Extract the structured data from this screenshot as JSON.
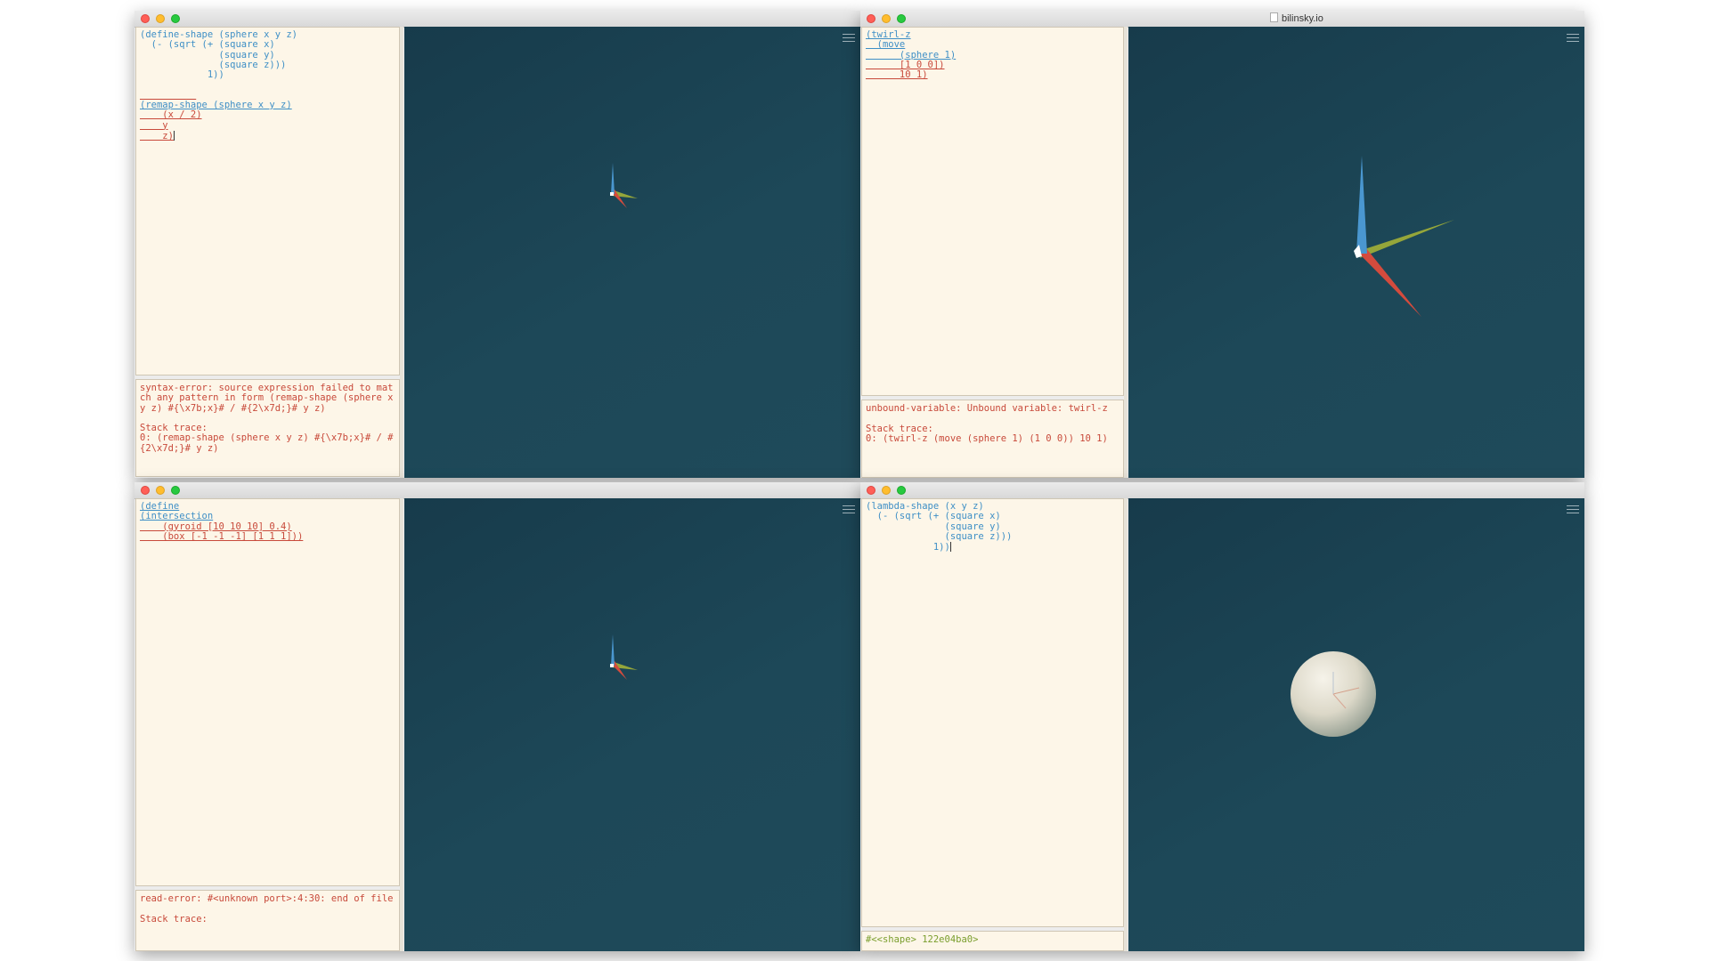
{
  "window_title": "bilinsky.io",
  "panes": {
    "tl": {
      "code_lines": [
        "(define-shape (sphere x y z)",
        "  (- (sqrt (+ (square x)",
        "              (square y)",
        "              (square z)))",
        "            1))",
        "",
        "",
        "(remap-shape (sphere x y z)",
        "    (x / 2)",
        "    y",
        "    z)"
      ],
      "console_text": "syntax-error: source expression failed to match any pattern in form (remap-shape (sphere x y z) #{\\x7b;x}# / #{2\\x7d;}# y z)\n\nStack trace:\n0: (remap-shape (sphere x y z) #{\\x7b;x}# / #{2\\x7d;}# y z)"
    },
    "tr": {
      "code_lines": [
        "(twirl-z",
        "  (move",
        "      (sphere 1)",
        "      [1 0 0])",
        "      10 1)"
      ],
      "console_text": "unbound-variable: Unbound variable: twirl-z\n\nStack trace:\n0: (twirl-z (move (sphere 1) (1 0 0)) 10 1)"
    },
    "bl": {
      "code_lines": [
        "(define",
        "(intersection",
        "    (gyroid [10 10 10] 0.4)",
        "    (box [-1 -1 -1] [1 1 1]))"
      ],
      "console_text": "read-error: #<unknown port>:4:30: end of file\n\nStack trace:"
    },
    "br": {
      "code_lines": [
        "(lambda-shape (x y z)",
        "  (- (sqrt (+ (square x)",
        "              (square y)",
        "              (square z)))",
        "            1))"
      ],
      "console_text": "#<<shape> 122e04ba0>"
    }
  },
  "icons": {
    "menu": "hamburger-menu-icon",
    "close": "close-traffic-light",
    "minimize": "minimize-traffic-light",
    "maximize": "maximize-traffic-light"
  },
  "colors": {
    "viewport_bg": "#1d4858",
    "editor_bg": "#fdf6e8",
    "code_blue": "#3e8fc6",
    "error_red": "#c8493a",
    "result_green": "#7a9e2d",
    "axis_x": "#d44b3d",
    "axis_y": "#95a63a",
    "axis_z": "#4a97d0"
  }
}
